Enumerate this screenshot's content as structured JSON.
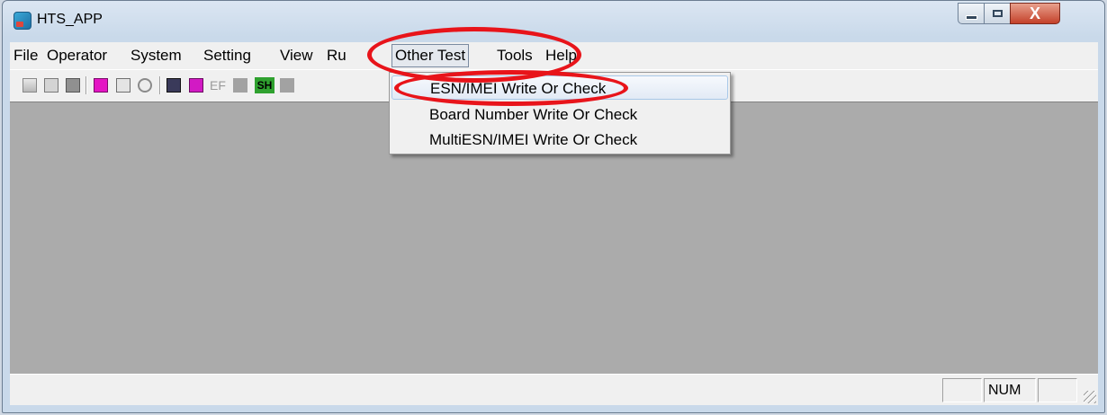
{
  "window": {
    "title": "HTS_APP",
    "app_icon": "hts-app-icon",
    "close_glyph": "X"
  },
  "menubar": {
    "items": [
      {
        "label": "File"
      },
      {
        "label": "Operator"
      },
      {
        "label": "System"
      },
      {
        "label": "Setting"
      },
      {
        "label": "View"
      },
      {
        "label": "Ru"
      },
      {
        "label": "Other Test",
        "active": true
      },
      {
        "label": "Tools"
      },
      {
        "label": "Help"
      }
    ]
  },
  "toolbar": {
    "icons": [
      "open-icon",
      "properties-icon",
      "save-icon",
      "key-icon",
      "play-icon",
      "stop-icon",
      "calculator-icon",
      "notebook-icon",
      "ef-icon",
      "gray-square-icon",
      "sh-icon",
      "gray-square-icon"
    ],
    "ef_label": "EF",
    "sh_label": "SH"
  },
  "dropdown": {
    "items": [
      {
        "label": "ESN/IMEI Write Or Check",
        "highlighted": true
      },
      {
        "label": "Board Number Write Or Check"
      },
      {
        "label": "MultiESN/IMEI Write Or Check"
      }
    ]
  },
  "statusbar": {
    "num_indicator": "NUM"
  },
  "annotations": {
    "callout_color": "#e8141a"
  }
}
